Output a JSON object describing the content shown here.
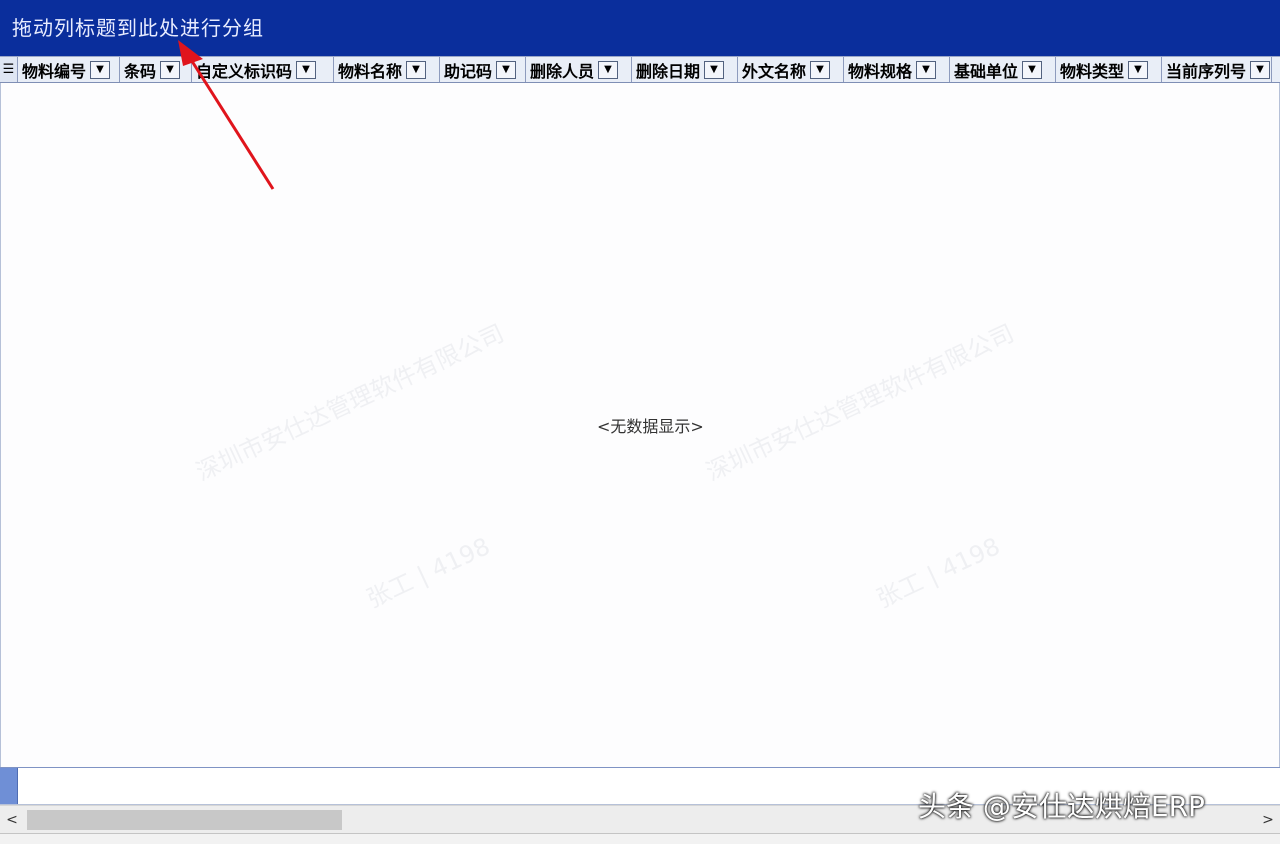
{
  "group_panel": {
    "hint": "拖动列标题到此处进行分组"
  },
  "row_indicator_glyph": "☰",
  "columns": [
    {
      "label": "物料编号",
      "width": 102
    },
    {
      "label": "条码",
      "width": 72
    },
    {
      "label": "自定义标识码",
      "width": 142
    },
    {
      "label": "物料名称",
      "width": 106
    },
    {
      "label": "助记码",
      "width": 86
    },
    {
      "label": "删除人员",
      "width": 106
    },
    {
      "label": "删除日期",
      "width": 106
    },
    {
      "label": "外文名称",
      "width": 106
    },
    {
      "label": "物料规格",
      "width": 106
    },
    {
      "label": "基础单位",
      "width": 106
    },
    {
      "label": "物料类型",
      "width": 106
    },
    {
      "label": "当前序列号",
      "width": 110
    }
  ],
  "grid": {
    "empty_text": "<无数据显示>"
  },
  "watermark": {
    "company": "深圳市安仕达管理软件有限公司",
    "user": "张工 | 4198"
  },
  "scrollbar": {
    "left_arrow": "<",
    "right_arrow": ">"
  },
  "credit": "头条 @安仕达烘焙ERP",
  "colors": {
    "group_panel_bg": "#0a2e9c",
    "annotation_arrow": "#e0141c"
  }
}
